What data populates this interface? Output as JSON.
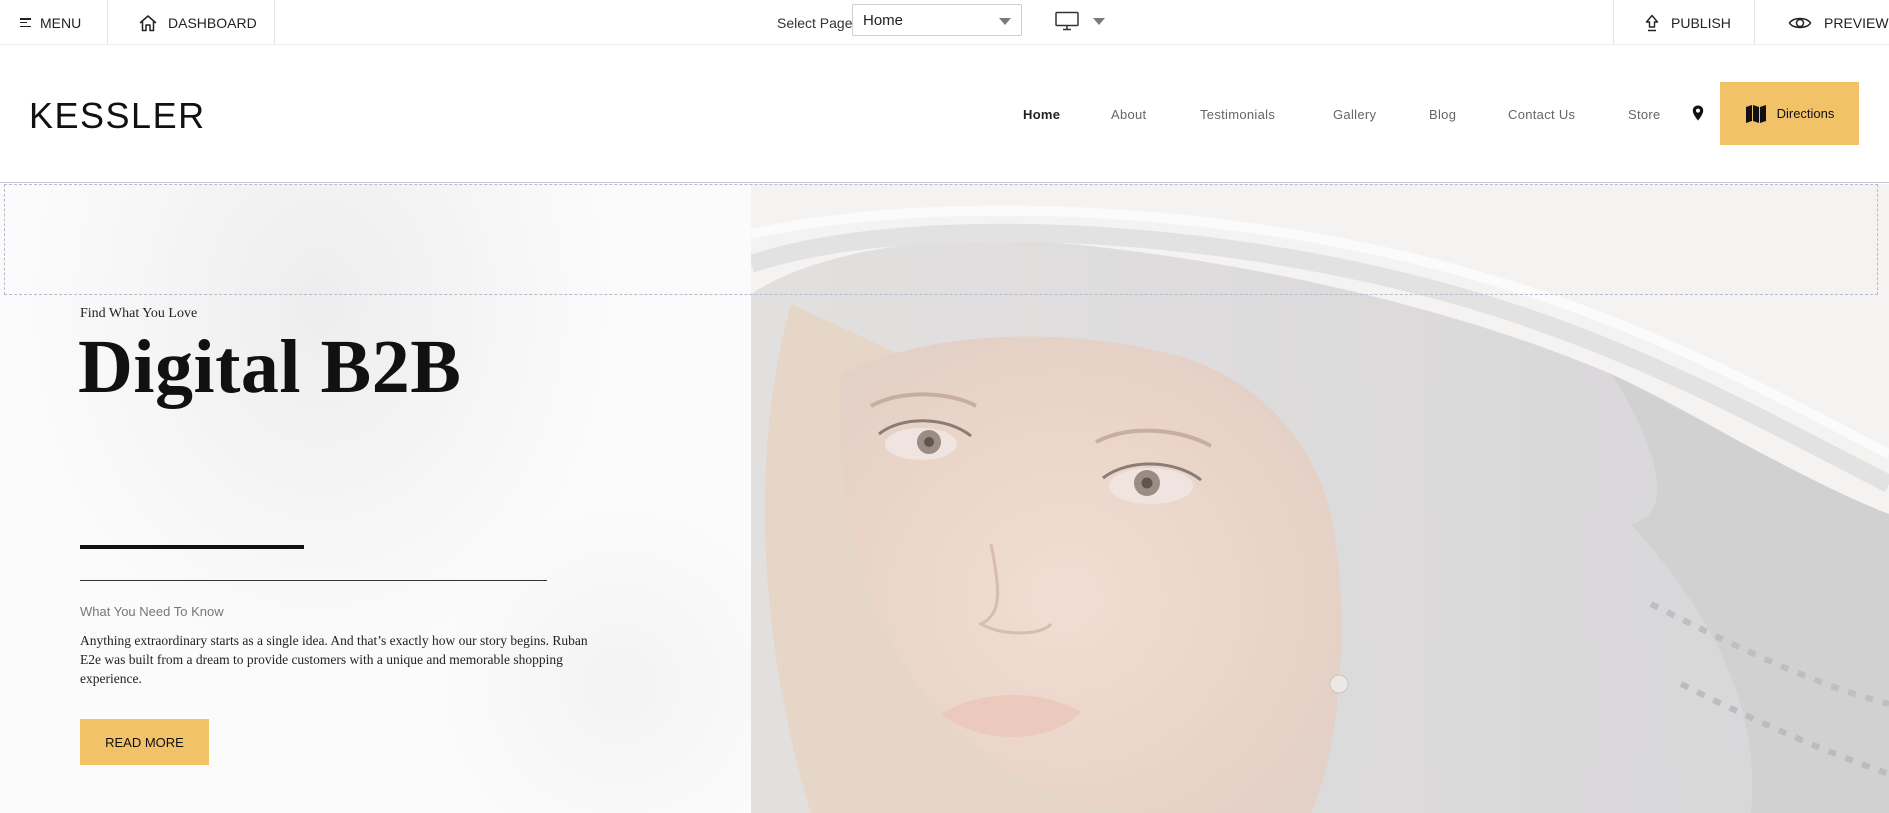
{
  "toolbar": {
    "menu_label": "MENU",
    "dashboard_label": "DASHBOARD",
    "select_page_label": "Select Page",
    "selected_page": "Home",
    "publish_label": "PUBLISH",
    "preview_label": "PREVIEW"
  },
  "site": {
    "logo": "KESSLER",
    "nav": [
      {
        "label": "Home",
        "active": true
      },
      {
        "label": "About"
      },
      {
        "label": "Testimonials"
      },
      {
        "label": "Gallery"
      },
      {
        "label": "Blog"
      },
      {
        "label": "Contact Us"
      },
      {
        "label": "Store"
      }
    ],
    "directions_label": "Directions",
    "accent_color": "#f2c268"
  },
  "hero": {
    "eyebrow": "Find What You Love",
    "headline": "Digital B2B",
    "sub_title": "What You Need To Know",
    "body": "Anything extraordinary starts as a single idea. And that’s exactly how our story begins. Ruban E2e was built from a dream to provide customers with a unique and memorable shopping experience.",
    "cta_label": "READ MORE"
  }
}
